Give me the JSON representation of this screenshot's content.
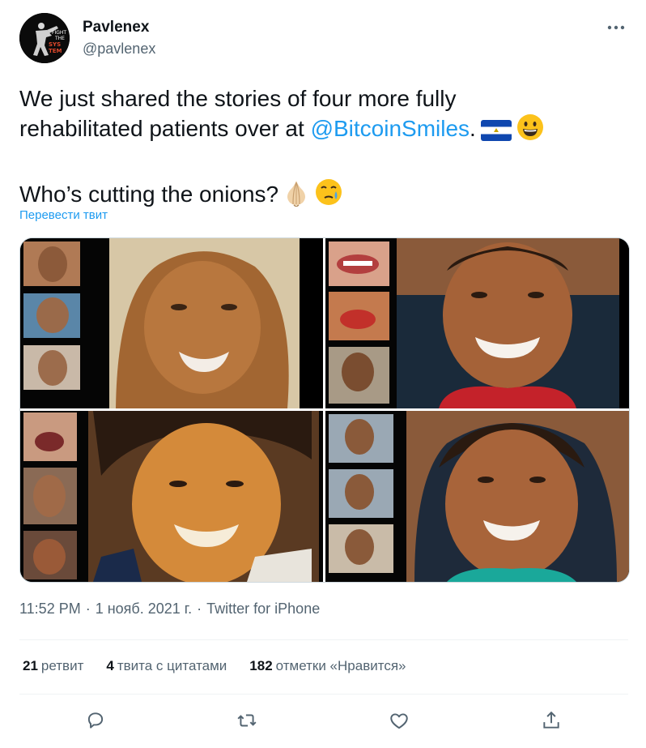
{
  "author": {
    "name": "Pavlenex",
    "handle": "@pavlenex",
    "avatar_text": [
      "FIGHT",
      "THE",
      "SYS",
      "TEM"
    ]
  },
  "tweet": {
    "line1": "We just shared the stories of four more fully",
    "line2_pre": "rehabilitated patients over at ",
    "mention": "@BitcoinSmiles",
    "line2_post": ".",
    "line3": "Who’s cutting the onions?",
    "translate": "Перевести твит",
    "emojis": [
      "el-salvador-flag-icon",
      "grinning-face-icon",
      "onion-icon",
      "face-holding-back-tears-icon"
    ]
  },
  "media": {
    "count": 4
  },
  "meta": {
    "time": "11:52 PM",
    "date": "1 нояб. 2021 г.",
    "separator": "·",
    "source": "Twitter for iPhone"
  },
  "stats": {
    "retweets_count": "21",
    "retweets_label": "ретвит",
    "quotes_count": "4",
    "quotes_label": "твита с цитатами",
    "likes_count": "182",
    "likes_label": "отметки «Нравится»"
  },
  "actions": [
    "reply-icon",
    "retweet-icon",
    "like-icon",
    "share-icon"
  ],
  "colors": {
    "accent": "#1d9bf0",
    "text": "#0f1419",
    "secondary": "#536471",
    "divider": "#eff3f4"
  }
}
